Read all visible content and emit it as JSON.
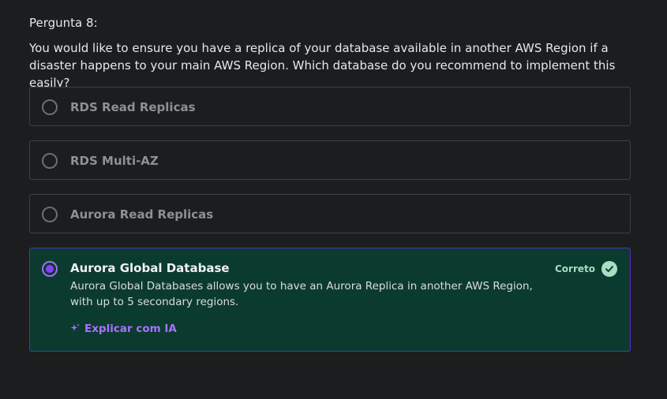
{
  "question": {
    "number_label": "Pergunta 8:",
    "text": "You would like to ensure you have a replica of your database available in another AWS Region if a disaster happens to your main AWS Region. Which database do you recommend to implement this easily?"
  },
  "options": [
    {
      "label": "RDS Read Replicas"
    },
    {
      "label": "RDS Multi-AZ"
    },
    {
      "label": "Aurora Read Replicas"
    },
    {
      "label": "Aurora Global Database",
      "explanation": "Aurora Global Databases allows you to have an Aurora Replica in another AWS Region, with up to 5 secondary regions.",
      "status_label": "Correto",
      "status_icon": "check-circle-icon",
      "ai_link_label": "Explicar com IA",
      "ai_icon": "sparkle-icon"
    }
  ],
  "colors": {
    "background": "#1c1d1f",
    "correct_bg": "#0b3b2e",
    "accent_purple": "#8a3ffc",
    "correct_green": "#a8dec4"
  }
}
